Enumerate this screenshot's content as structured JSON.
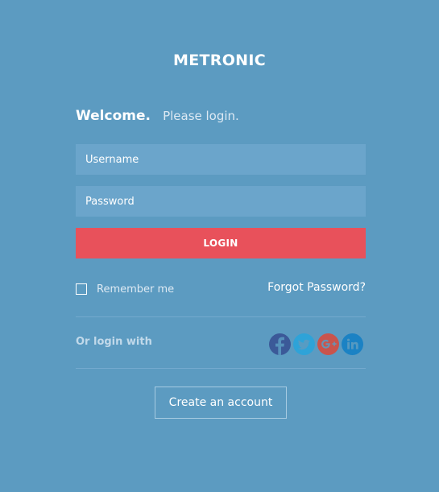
{
  "brand": {
    "name": "METRONIC"
  },
  "welcome": {
    "title": "Welcome.",
    "subtitle": "Please login."
  },
  "form": {
    "username_placeholder": "Username",
    "password_placeholder": "Password",
    "login_label": "LOGIN",
    "remember_label": "Remember me",
    "remember_checked": false,
    "forgot_label": "Forgot Password?"
  },
  "social": {
    "label": "Or login with",
    "providers": [
      {
        "name": "facebook-icon",
        "color": "#3b5998"
      },
      {
        "name": "twitter-icon",
        "color": "#2ea3d8"
      },
      {
        "name": "google-plus-icon",
        "color": "#c9544c"
      },
      {
        "name": "linkedin-icon",
        "color": "#1b82c4"
      }
    ]
  },
  "signup": {
    "label": "Create an account"
  },
  "colors": {
    "background": "#5c9bc1",
    "input": "#6ba5cb",
    "login_button": "#e8515b"
  }
}
